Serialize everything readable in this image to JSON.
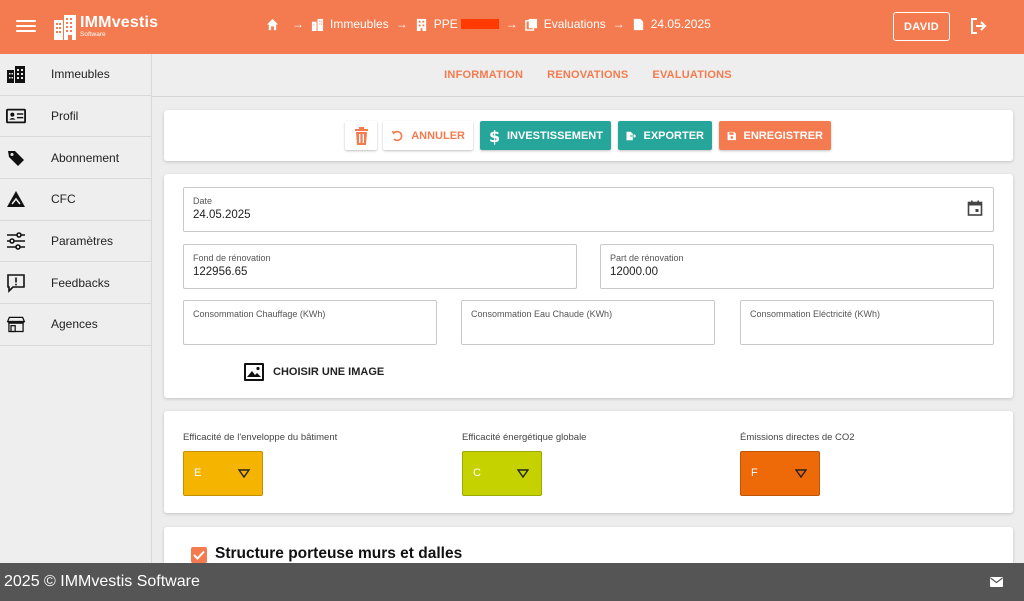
{
  "header": {
    "logo_text": "IMMvestis",
    "logo_subtext": "Software",
    "breadcrumb": [
      "Immeubles",
      "PPE",
      "Evaluations",
      "24.05.2025"
    ],
    "user_label": "DAVID"
  },
  "sidebar": {
    "items": [
      {
        "label": "Immeubles",
        "icon": "buildings-icon"
      },
      {
        "label": "Profil",
        "icon": "id-card-icon"
      },
      {
        "label": "Abonnement",
        "icon": "tag-icon"
      },
      {
        "label": "CFC",
        "icon": "road-sign-icon"
      },
      {
        "label": "Paramètres",
        "icon": "sliders-icon"
      },
      {
        "label": "Feedbacks",
        "icon": "feedback-icon"
      },
      {
        "label": "Agences",
        "icon": "store-icon"
      }
    ]
  },
  "tabs": [
    "INFORMATION",
    "RENOVATIONS",
    "EVALUATIONS"
  ],
  "toolbar": {
    "cancel_label": "ANNULER",
    "invest_label": "INVESTISSEMENT",
    "export_label": "EXPORTER",
    "save_label": "ENREGISTRER"
  },
  "form": {
    "date_label": "Date",
    "date_value": "24.05.2025",
    "fond_label": "Fond de rénovation",
    "fond_value": "122956.65",
    "part_label": "Part de rénovation",
    "part_value": "12000.00",
    "chauffage_label": "Consommation Chauffage (KWh)",
    "chauffage_value": "",
    "eau_label": "Consommation Eau Chaude (KWh)",
    "eau_value": "",
    "elec_label": "Consommation Eléctricité (KWh)",
    "elec_value": "",
    "image_label": "CHOISIR UNE IMAGE"
  },
  "efficiency": [
    {
      "label": "Efficacité de l'enveloppe du bâtiment",
      "value": "E",
      "color": "#f5b400"
    },
    {
      "label": "Efficacité énergétique globale",
      "value": "C",
      "color": "#c5d200"
    },
    {
      "label": "Émissions directes de CO2",
      "value": "F",
      "color": "#ee6a08"
    }
  ],
  "section": {
    "title": "Structure porteuse murs et dalles",
    "checked": true
  },
  "footer": {
    "text": "2025 © IMMvestis Software"
  },
  "colors": {
    "primary": "#f47b4f",
    "teal": "#26a69a",
    "footer": "#555555"
  }
}
